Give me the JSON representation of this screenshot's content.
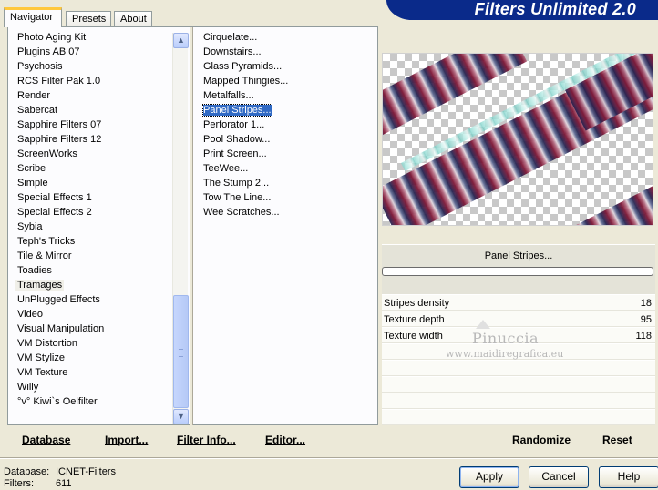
{
  "tabs": [
    "Navigator",
    "Presets",
    "About"
  ],
  "banner_title": "Filters Unlimited 2.0",
  "categories": [
    "Photo Aging Kit",
    "Plugins AB 07",
    "Psychosis",
    "RCS Filter Pak 1.0",
    "Render",
    "Sabercat",
    "Sapphire Filters 07",
    "Sapphire Filters 12",
    "ScreenWorks",
    "Scribe",
    "Simple",
    "Special Effects 1",
    "Special Effects 2",
    "Sybia",
    "Teph's Tricks",
    "Tile & Mirror",
    "Toadies",
    "Tramages",
    "UnPlugged Effects",
    "Video",
    "Visual Manipulation",
    "VM Distortion",
    "VM Stylize",
    "VM Texture",
    "Willy",
    "°v° Kiwi`s Oelfilter"
  ],
  "selected_category": "Tramages",
  "filters": [
    "Cirquelate...",
    "Downstairs...",
    "Glass Pyramids...",
    "Mapped Thingies...",
    "Metalfalls...",
    "Panel Stripes...",
    "Perforator 1...",
    "Pool Shadow...",
    "Print Screen...",
    "TeeWee...",
    "The Stump 2...",
    "Tow The Line...",
    "Wee Scratches..."
  ],
  "selected_filter": "Panel Stripes...",
  "left_buttons": {
    "database": "Database",
    "import": "Import...",
    "filter_info": "Filter Info...",
    "editor": "Editor..."
  },
  "right_buttons": {
    "randomize": "Randomize",
    "reset": "Reset"
  },
  "filter_name": "Panel Stripes...",
  "params": [
    {
      "name": "Stripes density",
      "value": "18"
    },
    {
      "name": "Texture depth",
      "value": "95"
    },
    {
      "name": "Texture width",
      "value": "118"
    }
  ],
  "watermark": {
    "name": "Pinuccia",
    "url": "www.maidiregrafica.eu"
  },
  "status": {
    "database_label": "Database:",
    "database_value": "ICNET-Filters",
    "filters_label": "Filters:",
    "filters_value": "611"
  },
  "dialog_buttons": {
    "apply": "Apply",
    "cancel": "Cancel",
    "help": "Help"
  },
  "colors": {
    "banner": "#0a2a8a",
    "selection": "#316ac5",
    "tab_highlight": "#ffc83c"
  }
}
